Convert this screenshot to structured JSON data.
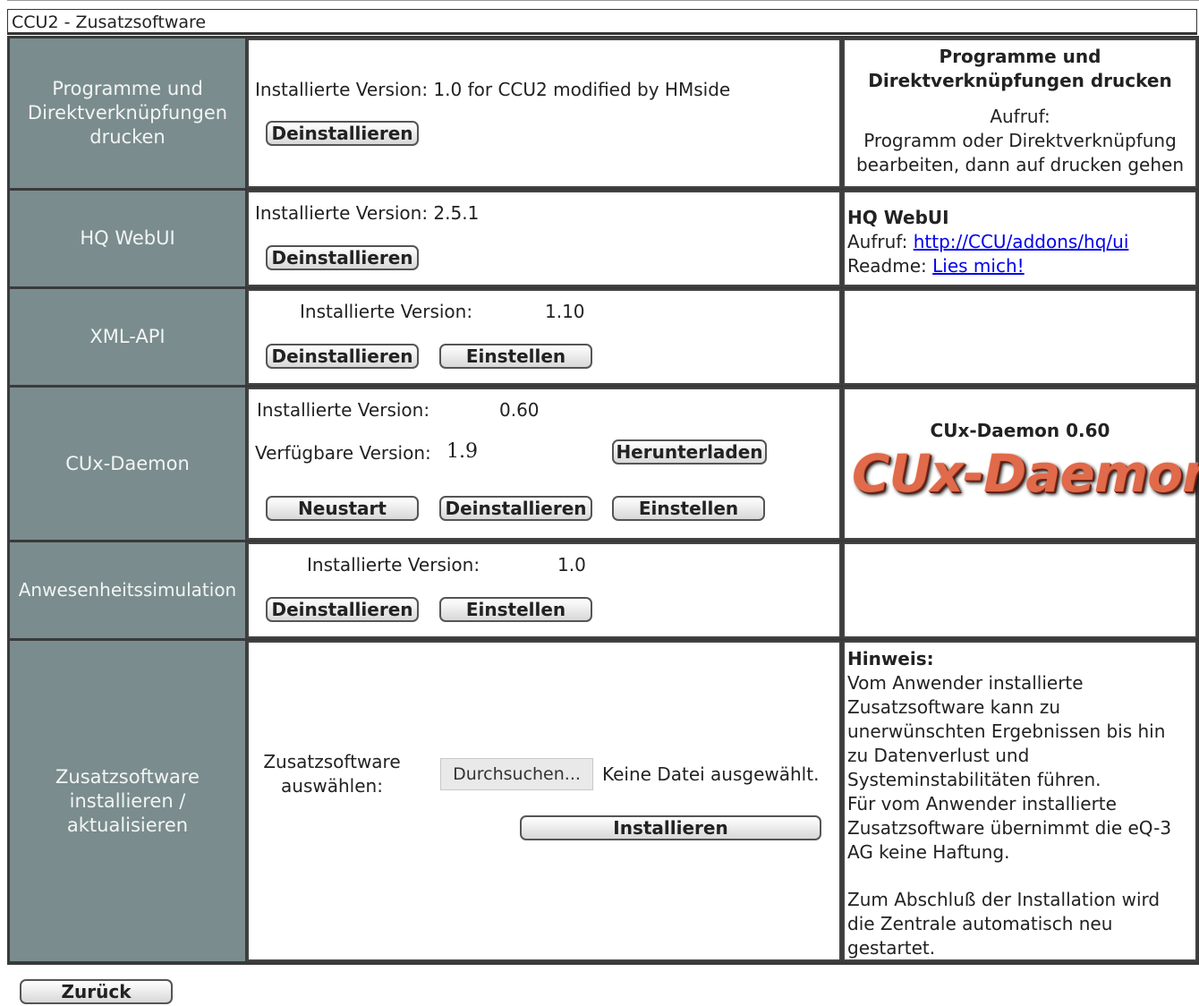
{
  "window": {
    "title": "CCU2 - Zusatzsoftware"
  },
  "rows": [
    {
      "name": "Programme und Direktverknüpfungen drucken",
      "name_lines": [
        "Programme und",
        "Direktverknüpfungen",
        "drucken"
      ],
      "installed_label": "Installierte Version: 1.0 for CCU2 modified by HMside",
      "buttons": [
        "Deinstallieren"
      ],
      "info": {
        "title_lines": [
          "Programme und",
          "Direktverknüpfungen drucken"
        ],
        "call_label": "Aufruf:",
        "call_lines": [
          "Programm oder Direktverknüpfung",
          "bearbeiten, dann auf drucken gehen"
        ]
      }
    },
    {
      "name": "HQ WebUI",
      "installed_label": "Installierte Version: 2.5.1",
      "buttons": [
        "Deinstallieren"
      ],
      "info": {
        "title": "HQ WebUI",
        "call_label": "Aufruf:",
        "call_link": "http://CCU/addons/hq/ui",
        "readme_label": "Readme:",
        "readme_link": "Lies mich!"
      }
    },
    {
      "name": "XML-API",
      "installed_label": "Installierte Version:",
      "installed_value": "1.10",
      "buttons": [
        "Deinstallieren",
        "Einstellen"
      ]
    },
    {
      "name": "CUx-Daemon",
      "installed_label": "Installierte Version:",
      "installed_value": "0.60",
      "available_label": "Verfügbare Version:",
      "available_value": "1.9",
      "download_button": "Herunterladen",
      "buttons": [
        "Neustart",
        "Deinstallieren",
        "Einstellen"
      ],
      "info": {
        "title": "CUx-Daemon 0.60",
        "logo_text": "CUx-Daemon"
      }
    },
    {
      "name": "Anwesenheitssimulation",
      "installed_label": "Installierte Version:",
      "installed_value": "1.0",
      "buttons": [
        "Deinstallieren",
        "Einstellen"
      ]
    },
    {
      "name": "Zusatzsoftware installieren / aktualisieren",
      "name_lines": [
        "Zusatzsoftware",
        "installieren /",
        "aktualisieren"
      ],
      "select_label_lines": [
        "Zusatzsoftware",
        "auswählen:"
      ],
      "browse_button": "Durchsuchen...",
      "file_status": "Keine Datei ausgewählt.",
      "install_button": "Installieren",
      "info": {
        "hint_title": "Hinweis:",
        "hint_lines": [
          "Vom Anwender installierte",
          "Zusatzsoftware kann zu",
          "unerwünschten Ergebnissen bis hin",
          "zu Datenverlust und",
          "Systeminstabilitäten führen.",
          "Für vom Anwender installierte",
          "Zusatzsoftware übernimmt die eQ-3",
          "AG keine Haftung."
        ],
        "restart_lines": [
          "Zum Abschluß der Installation wird",
          "die Zentrale automatisch neu",
          "gestartet."
        ]
      }
    }
  ],
  "footer": {
    "back_button": "Zurück"
  }
}
